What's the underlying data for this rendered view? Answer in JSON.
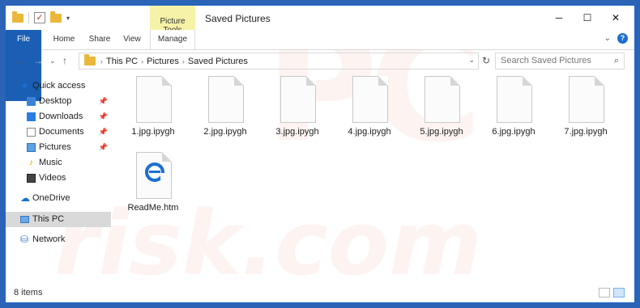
{
  "window": {
    "title": "Saved Pictures",
    "context_tab_group": "Picture Tools",
    "controls": {
      "minimize": "─",
      "maximize": "☐",
      "close": "✕"
    }
  },
  "ribbon": {
    "tabs": [
      "File",
      "Home",
      "Share",
      "View",
      "Manage"
    ],
    "expand_icon": "chevron-down-icon",
    "help_label": "?"
  },
  "address_bar": {
    "breadcrumbs": [
      "This PC",
      "Pictures",
      "Saved Pictures"
    ]
  },
  "search": {
    "placeholder": "Search Saved Pictures"
  },
  "nav_pane": {
    "items": [
      {
        "label": "Quick access",
        "icon": "star-icon"
      },
      {
        "label": "Desktop",
        "icon": "desktop-icon",
        "pinned": true
      },
      {
        "label": "Downloads",
        "icon": "download-icon",
        "pinned": true
      },
      {
        "label": "Documents",
        "icon": "documents-icon",
        "pinned": true
      },
      {
        "label": "Pictures",
        "icon": "pictures-icon",
        "pinned": true
      },
      {
        "label": "Music",
        "icon": "music-icon"
      },
      {
        "label": "Videos",
        "icon": "videos-icon"
      },
      {
        "label": "OneDrive",
        "icon": "cloud-icon"
      },
      {
        "label": "This PC",
        "icon": "computer-icon",
        "selected": true
      },
      {
        "label": "Network",
        "icon": "network-icon"
      }
    ]
  },
  "files": [
    {
      "name": "1.jpg.ipygh",
      "icon": "blank-file-icon"
    },
    {
      "name": "2.jpg.ipygh",
      "icon": "blank-file-icon"
    },
    {
      "name": "3.jpg.ipygh",
      "icon": "blank-file-icon"
    },
    {
      "name": "4.jpg.ipygh",
      "icon": "blank-file-icon"
    },
    {
      "name": "5.jpg.ipygh",
      "icon": "blank-file-icon"
    },
    {
      "name": "6.jpg.ipygh",
      "icon": "blank-file-icon"
    },
    {
      "name": "7.jpg.ipygh",
      "icon": "blank-file-icon"
    },
    {
      "name": "ReadMe.htm",
      "icon": "edge-html-icon"
    }
  ],
  "status_bar": {
    "item_count": "8 items"
  },
  "watermark": {
    "text": "risk.com"
  },
  "colors": {
    "accent": "#1a5fb4",
    "context_tab": "#f6f3a8",
    "selection": "#d9d9d9"
  }
}
